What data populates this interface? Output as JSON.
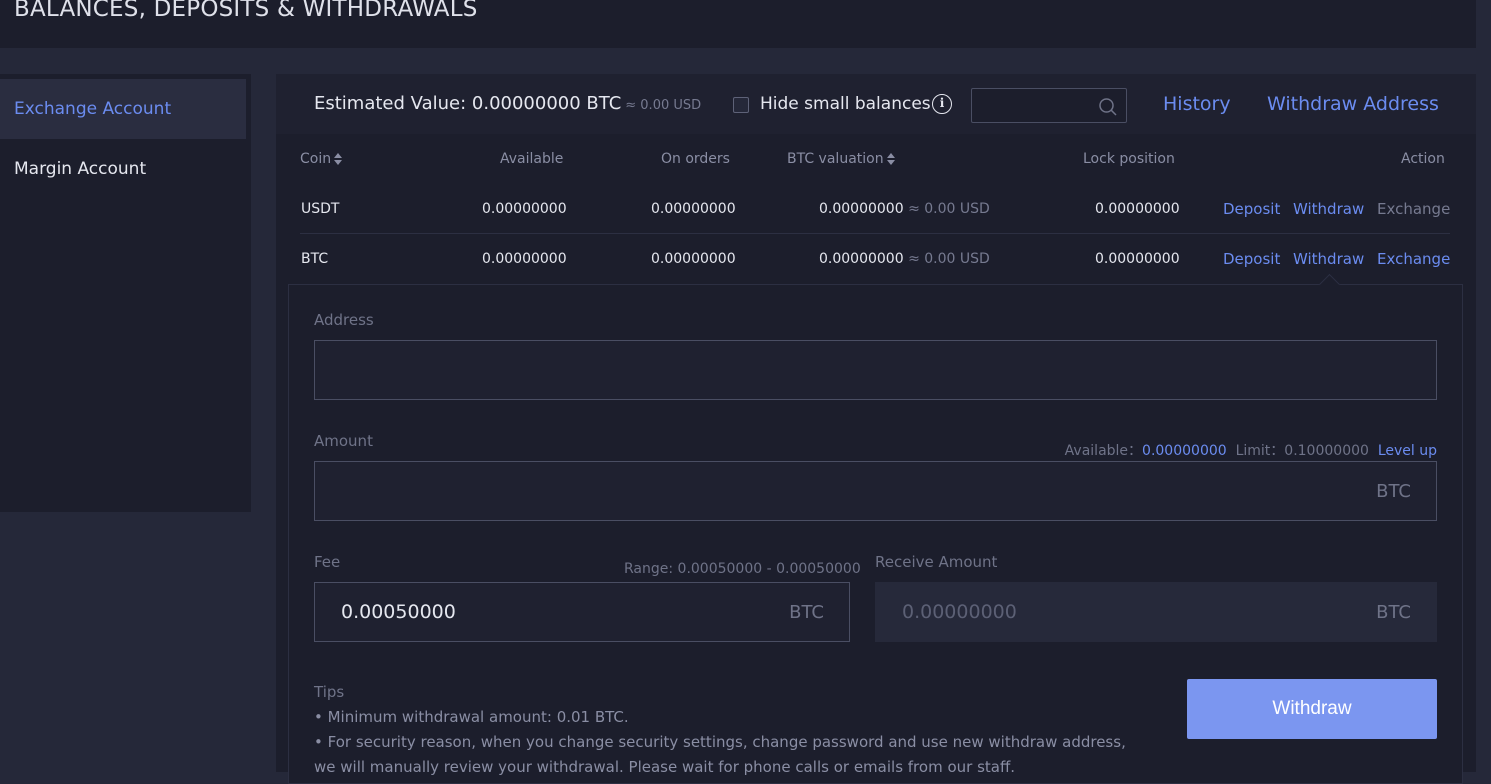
{
  "page": {
    "title": "BALANCES, DEPOSITS & WITHDRAWALS"
  },
  "sidebar": {
    "items": [
      {
        "label": "Exchange Account",
        "active": true
      },
      {
        "label": "Margin Account",
        "active": false
      }
    ]
  },
  "header": {
    "estimated_label": "Estimated Value:",
    "estimated_value": "0.00000000 BTC",
    "estimated_usd": "≈ 0.00 USD",
    "hide_small_label": "Hide small balances",
    "hide_small_checked": false,
    "search": {
      "value": "",
      "placeholder": ""
    },
    "history_link": "History",
    "withdraw_address_link": "Withdraw Address"
  },
  "table": {
    "columns": [
      "Coin",
      "Available",
      "On orders",
      "BTC valuation",
      "Lock position",
      "Action"
    ],
    "rows": [
      {
        "coin": "USDT",
        "available": "0.00000000",
        "on_orders": "0.00000000",
        "btc_valuation": "0.00000000",
        "usd_valuation": "≈ 0.00 USD",
        "lock_position": "0.00000000",
        "actions": {
          "deposit": "Deposit",
          "withdraw": "Withdraw",
          "exchange": "Exchange"
        }
      },
      {
        "coin": "BTC",
        "available": "0.00000000",
        "on_orders": "0.00000000",
        "btc_valuation": "0.00000000",
        "usd_valuation": "≈ 0.00 USD",
        "lock_position": "0.00000000",
        "actions": {
          "deposit": "Deposit",
          "withdraw": "Withdraw",
          "exchange": "Exchange"
        }
      }
    ]
  },
  "withdraw_form": {
    "address_label": "Address",
    "address_value": "",
    "amount_label": "Amount",
    "amount_value": "",
    "amount_unit": "BTC",
    "available_label": "Available：",
    "available_value": "0.00000000",
    "limit_label": "Limit：",
    "limit_value": "0.10000000",
    "level_up": "Level up",
    "fee_label": "Fee",
    "fee_range": "Range: 0.00050000 - 0.00050000",
    "fee_value": "0.00050000",
    "fee_unit": "BTC",
    "receive_label": "Receive Amount",
    "receive_value": "0.00000000",
    "receive_unit": "BTC",
    "tips_title": "Tips",
    "tips": [
      "• Minimum withdrawal amount: 0.01 BTC.",
      "• For security reason, when you change security settings, change password and use new withdraw address,",
      "we will manually review your withdrawal. Please wait for phone calls or emails from our staff."
    ],
    "submit_label": "Withdraw"
  },
  "colors": {
    "accent": "#6b8cf0",
    "button": "#7b96f0",
    "panel": "#1c1e2c",
    "background": "#252839"
  },
  "icons": {
    "info": "info-icon",
    "search": "search-icon",
    "sort": "sort-icon"
  }
}
